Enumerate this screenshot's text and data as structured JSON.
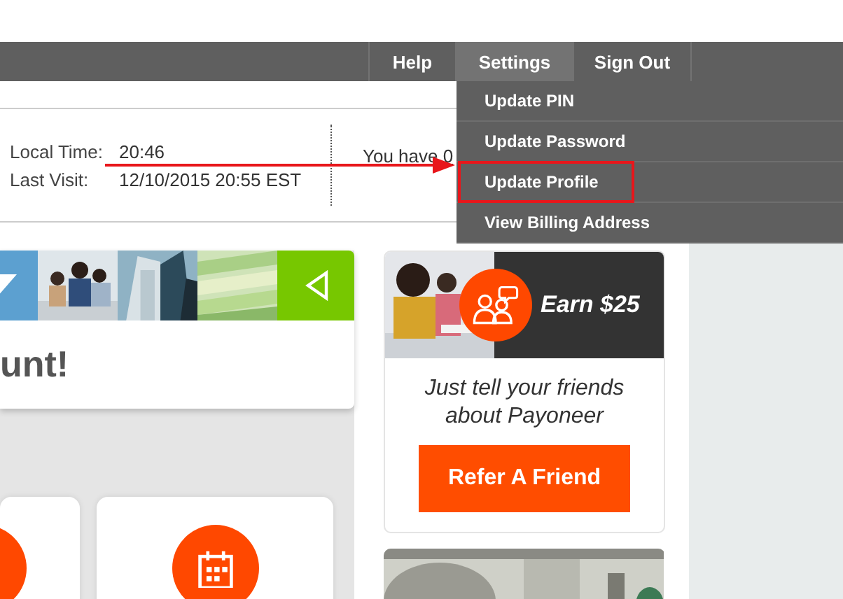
{
  "nav": {
    "items": [
      {
        "label": "Help",
        "selected": false
      },
      {
        "label": "Settings",
        "selected": true
      },
      {
        "label": "Sign Out",
        "selected": false
      }
    ]
  },
  "settings_menu": {
    "items": [
      {
        "label": "Update PIN",
        "highlighted": false
      },
      {
        "label": "Update Password",
        "highlighted": false
      },
      {
        "label": "Update Profile",
        "highlighted": true
      },
      {
        "label": "View Billing Address",
        "highlighted": false
      }
    ]
  },
  "info": {
    "rows": [
      {
        "label": "Local Time:",
        "value": "20:46"
      },
      {
        "label": "Last Visit:",
        "value": "12/10/2015 20:55 EST"
      }
    ],
    "notice_link": "You have 0"
  },
  "welcome_card": {
    "heading": "unt!"
  },
  "referral": {
    "title": "Earn $25",
    "text": "Just tell your friends about Payoneer",
    "button": "Refer A Friend"
  }
}
